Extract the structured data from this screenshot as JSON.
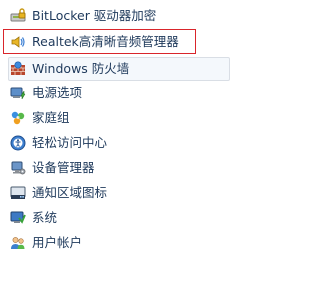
{
  "control_panel": {
    "items": [
      {
        "label": "BitLocker 驱动器加密",
        "icon": "bitlocker-drive-icon"
      },
      {
        "label": "Realtek高清晰音频管理器",
        "icon": "realtek-speaker-icon"
      },
      {
        "label": "Windows 防火墙",
        "icon": "firewall-icon"
      },
      {
        "label": "电源选项",
        "icon": "power-options-icon"
      },
      {
        "label": "家庭组",
        "icon": "homegroup-icon"
      },
      {
        "label": "轻松访问中心",
        "icon": "ease-of-access-icon"
      },
      {
        "label": "设备管理器",
        "icon": "device-manager-icon"
      },
      {
        "label": "通知区域图标",
        "icon": "notification-area-icon"
      },
      {
        "label": "系统",
        "icon": "system-icon"
      },
      {
        "label": "用户帐户",
        "icon": "user-accounts-icon"
      }
    ]
  },
  "colors": {
    "text": "#1e395b",
    "highlight_border": "#d9252b",
    "hover_border": "#d9dee5",
    "hover_fill": "#f4f8fc"
  }
}
